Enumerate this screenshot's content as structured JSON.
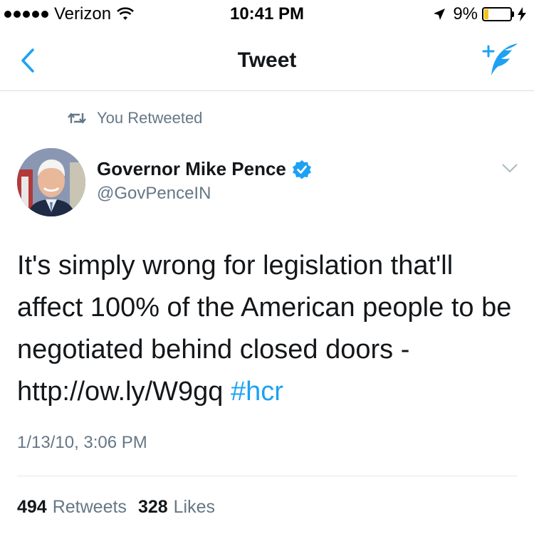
{
  "status_bar": {
    "carrier": "Verizon",
    "time": "10:41 PM",
    "battery": "9%",
    "battery_level": 0.09
  },
  "nav": {
    "title": "Tweet",
    "back_icon": "chevron-left-icon",
    "compose_icon": "compose-tweet-icon"
  },
  "retweet_context": "You Retweeted",
  "author": {
    "name": "Governor Mike Pence",
    "handle": "@GovPenceIN",
    "verified": true
  },
  "tweet": {
    "text_main": "It's simply wrong for legislation that'll affect 100% of the American people to be negotiated behind closed doors - ",
    "link": "http://ow.ly/W9gq",
    "hashtag": "#hcr",
    "timestamp": "1/13/10, 3:06 PM"
  },
  "stats": {
    "retweets_count": "494",
    "retweets_label": "Retweets",
    "likes_count": "328",
    "likes_label": "Likes"
  },
  "colors": {
    "accent": "#1da1f2",
    "secondary_text": "#657786",
    "primary_text": "#14171a",
    "battery_low": "#f5c518"
  }
}
